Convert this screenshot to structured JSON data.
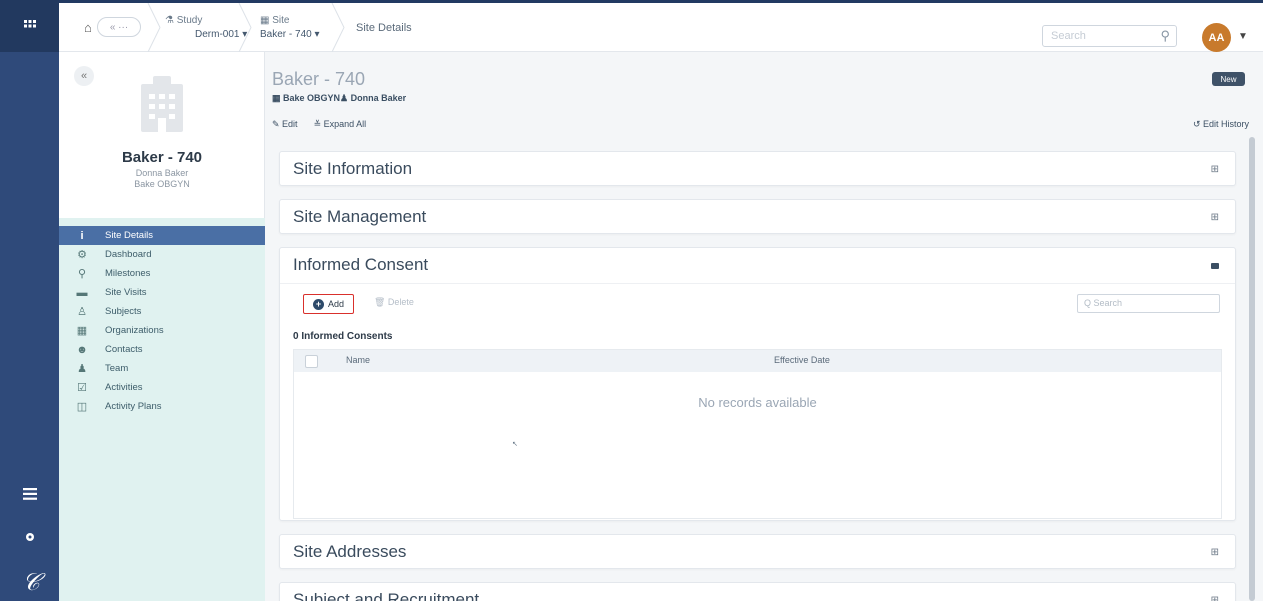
{
  "rail": {
    "grid_icon": "grid-icon",
    "list_icon": "list-icon",
    "settings_icon": "gear-icon",
    "logo_text": "𝒞"
  },
  "topbar": {
    "home_icon": "⌂",
    "back_label": "« ···",
    "study": {
      "label": "Study",
      "value": "Derm-001 ▾"
    },
    "site": {
      "label": "Site",
      "value": "Baker - 740 ▾"
    },
    "current": "Site Details",
    "search_placeholder": "Search",
    "avatar_initials": "AA"
  },
  "profile": {
    "collapse_label": "«",
    "name": "Baker - 740",
    "subtitle1": "Donna Baker",
    "subtitle2": "Bake OBGYN",
    "nav": [
      {
        "icon": "i",
        "label": "Site Details",
        "active": true
      },
      {
        "icon": "⚙",
        "label": "Dashboard"
      },
      {
        "icon": "⚲",
        "label": "Milestones"
      },
      {
        "icon": "▬",
        "label": "Site Visits"
      },
      {
        "icon": "♙",
        "label": "Subjects"
      },
      {
        "icon": "▦",
        "label": "Organizations"
      },
      {
        "icon": "☻",
        "label": "Contacts"
      },
      {
        "icon": "♟",
        "label": "Team"
      },
      {
        "icon": "☑",
        "label": "Activities"
      },
      {
        "icon": "◫",
        "label": "Activity Plans"
      }
    ]
  },
  "main": {
    "title": "Baker - 740",
    "sub": "▦ Bake OBGYN♟ Donna Baker",
    "badge": "New",
    "edit_label": "✎ Edit",
    "expand_label": "≚ Expand All",
    "edit_history": "↺ Edit History",
    "panels": {
      "site_info": "Site Information",
      "site_mgmt": "Site Management",
      "informed_consent": "Informed Consent",
      "site_addresses": "Site Addresses",
      "subject_recruitment": "Subject and Recruitment"
    },
    "consent": {
      "add_label": "Add",
      "delete_label": "🗑 Delete",
      "search_placeholder": "Q Search",
      "count_label": "0 Informed Consents",
      "columns": [
        "Name",
        "Effective Date"
      ],
      "empty": "No records available"
    }
  }
}
